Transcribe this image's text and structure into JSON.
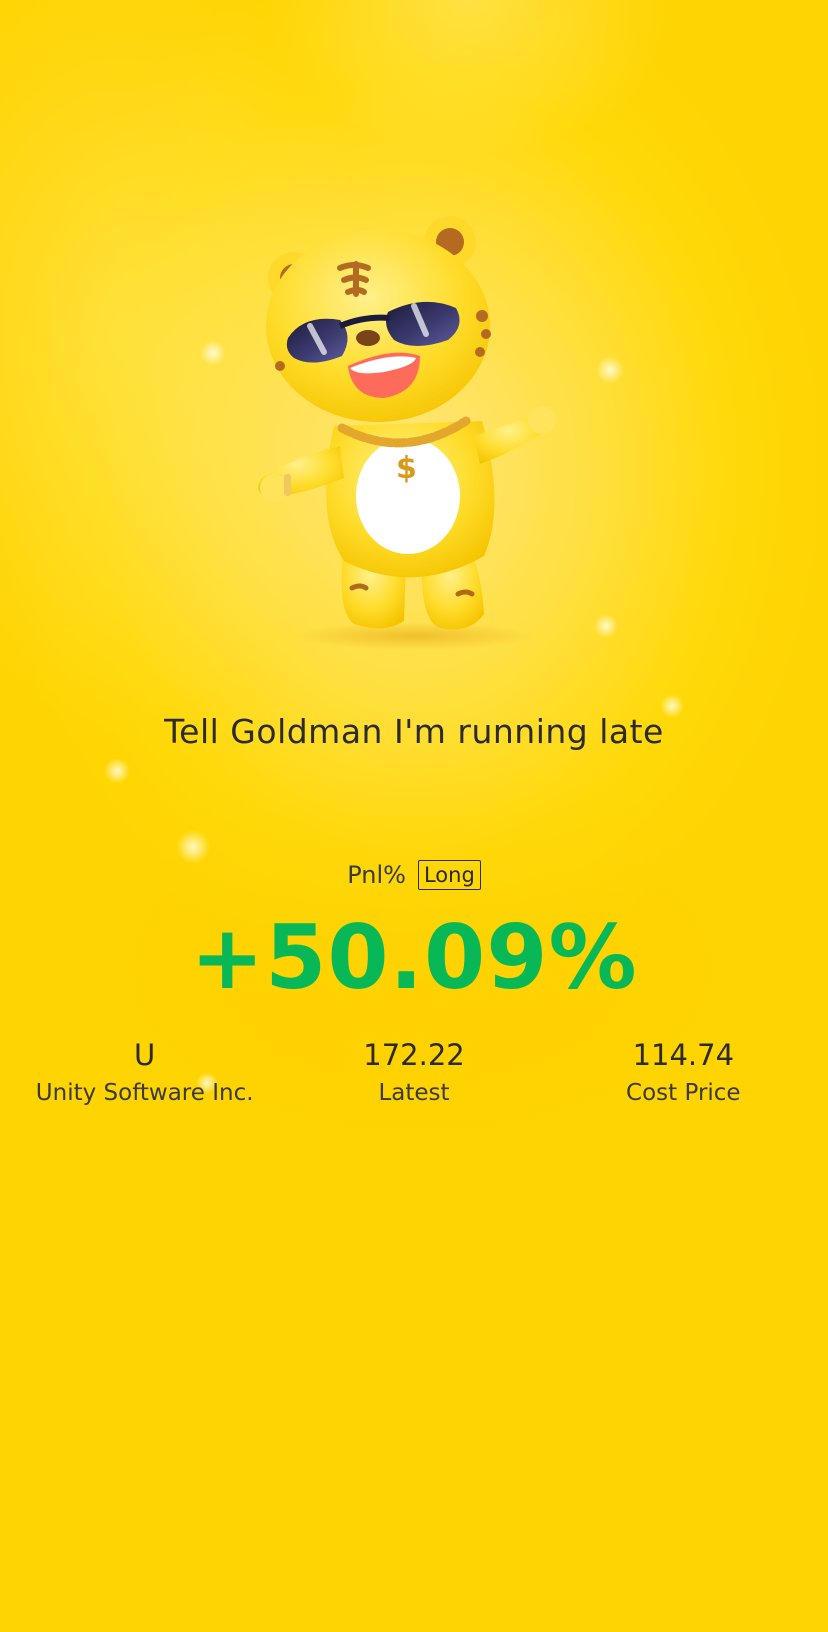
{
  "card": {
    "headline": "Tell Goldman I'm running late",
    "pnl_label": "Pnl%",
    "position_side": "Long",
    "pnl_value": "+50.09%",
    "pnl_color": "#08b857"
  },
  "stats": [
    {
      "value": "U",
      "label": "Unity Software Inc."
    },
    {
      "value": "172.22",
      "label": "Latest"
    },
    {
      "value": "114.74",
      "label": "Cost Price"
    }
  ],
  "colors": {
    "background": "#ffd90a",
    "text": "#2a2a2a"
  },
  "mascot": {
    "icon": "tiger-mascot-with-sunglasses-icon"
  }
}
